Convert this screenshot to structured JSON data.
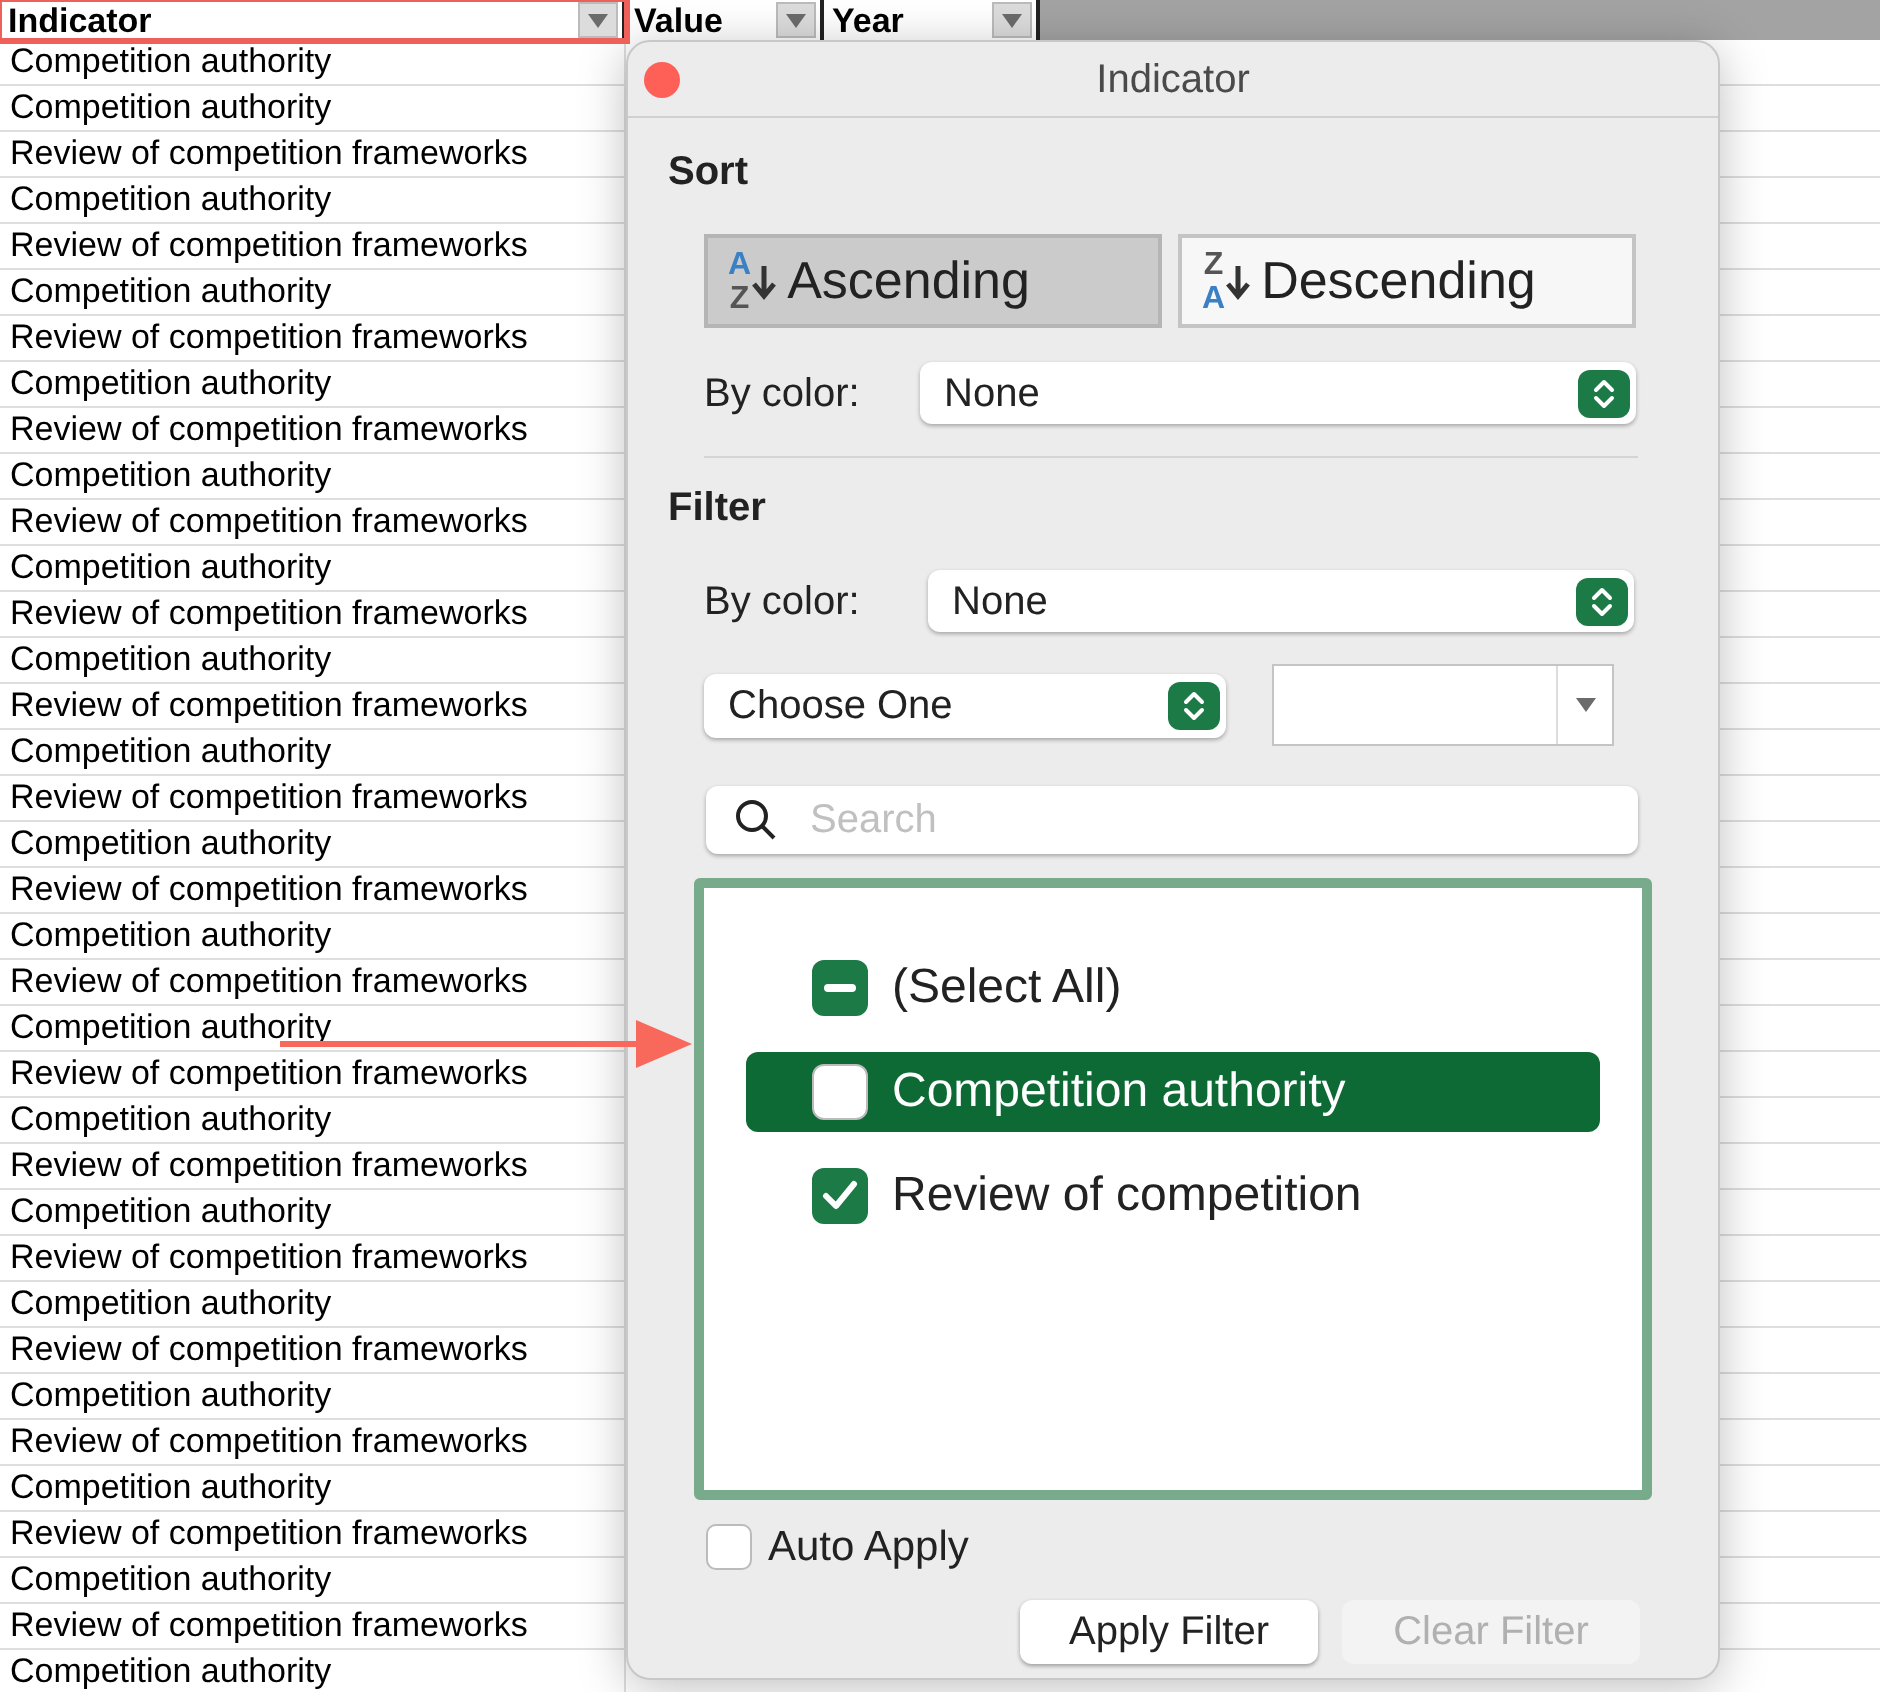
{
  "sheet": {
    "columns": [
      {
        "label": "Indicator",
        "highlighted": true
      },
      {
        "label": "Value",
        "highlighted": false
      },
      {
        "label": "Year",
        "highlighted": false
      }
    ],
    "rows": [
      "Competition authority",
      "Competition authority",
      "Review of competition frameworks",
      "Competition authority",
      "Review of competition frameworks",
      "Competition authority",
      "Review of competition frameworks",
      "Competition authority",
      "Review of competition frameworks",
      "Competition authority",
      "Review of competition frameworks",
      "Competition authority",
      "Review of competition frameworks",
      "Competition authority",
      "Review of competition frameworks",
      "Competition authority",
      "Review of competition frameworks",
      "Competition authority",
      "Review of competition frameworks",
      "Competition authority",
      "Review of competition frameworks",
      "Competition authority",
      "Review of competition frameworks",
      "Competition authority",
      "Review of competition frameworks",
      "Competition authority",
      "Review of competition frameworks",
      "Competition authority",
      "Review of competition frameworks",
      "Competition authority",
      "Review of competition frameworks",
      "Competition authority",
      "Review of competition frameworks",
      "Competition authority",
      "Review of competition frameworks",
      "Competition authority"
    ]
  },
  "dialog": {
    "title": "Indicator",
    "sort": {
      "heading": "Sort",
      "buttons": [
        {
          "label": "Ascending",
          "icon_top": "A",
          "icon_bottom": "Z",
          "selected": true
        },
        {
          "label": "Descending",
          "icon_top": "Z",
          "icon_bottom": "A",
          "selected": false
        }
      ],
      "by_color_label": "By color:",
      "by_color_value": "None"
    },
    "filter": {
      "heading": "Filter",
      "by_color_label": "By color:",
      "by_color_value": "None",
      "condition": "Choose One",
      "search": {
        "placeholder": "Search"
      },
      "items": [
        {
          "label": "(Select All)",
          "checked": true,
          "mixed": true,
          "selected": false
        },
        {
          "label": "Competition authority",
          "checked": false,
          "mixed": false,
          "selected": true
        },
        {
          "label": "Review of competition",
          "checked": true,
          "mixed": false,
          "selected": false
        }
      ]
    },
    "auto_apply": {
      "label": "Auto Apply",
      "checked": false
    },
    "buttons": [
      {
        "label": "Apply Filter",
        "disabled": false
      },
      {
        "label": "Clear Filter",
        "disabled": true
      }
    ]
  }
}
